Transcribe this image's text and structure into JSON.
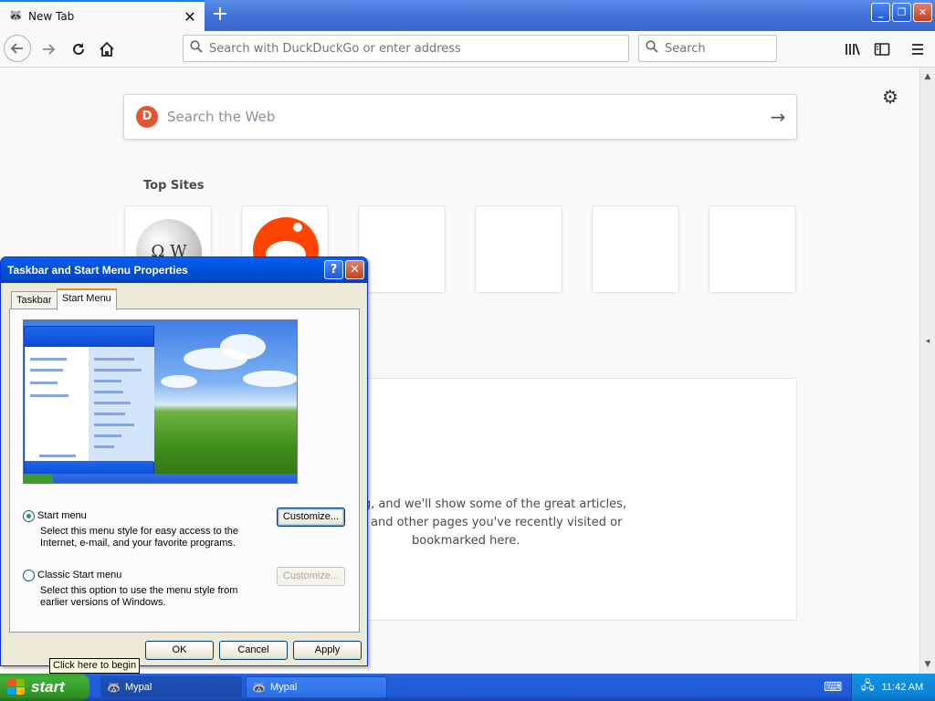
{
  "browser": {
    "tab_title": "New Tab",
    "tab_close": "✕",
    "new_tab": "+",
    "window_controls": {
      "minimize": "_",
      "restore": "❐",
      "close": "✕"
    },
    "url_placeholder": "Search with DuckDuckGo or enter address",
    "search_placeholder": "Search"
  },
  "newtab_page": {
    "search_placeholder": "Search the Web",
    "top_sites_title": "Top Sites",
    "highlights_message_line1": "ing, and we'll show some of the great articles,",
    "highlights_message_line2": "and other pages you've recently visited or",
    "highlights_message_line3": "bookmarked here."
  },
  "dialog": {
    "title": "Taskbar and Start Menu Properties",
    "help_btn": "?",
    "close_btn": "✕",
    "tabs": [
      {
        "label": "Taskbar"
      },
      {
        "label": "Start Menu"
      }
    ],
    "options": [
      {
        "label": "Start menu",
        "description": "Select this menu style for easy access to the Internet, e-mail, and your favorite programs.",
        "customize_label": "Customize..."
      },
      {
        "label": "Classic Start menu",
        "description": "Select this option to use the menu style from earlier versions of Windows.",
        "customize_label": "Customize..."
      }
    ],
    "buttons": {
      "ok": "OK",
      "cancel": "Cancel",
      "apply": "Apply"
    }
  },
  "tooltip": {
    "text": "Click here to begin"
  },
  "taskbar": {
    "start_label": "start",
    "items": [
      {
        "label": "Mypal"
      },
      {
        "label": "Mypal"
      }
    ],
    "clock": "11:42 AM"
  }
}
